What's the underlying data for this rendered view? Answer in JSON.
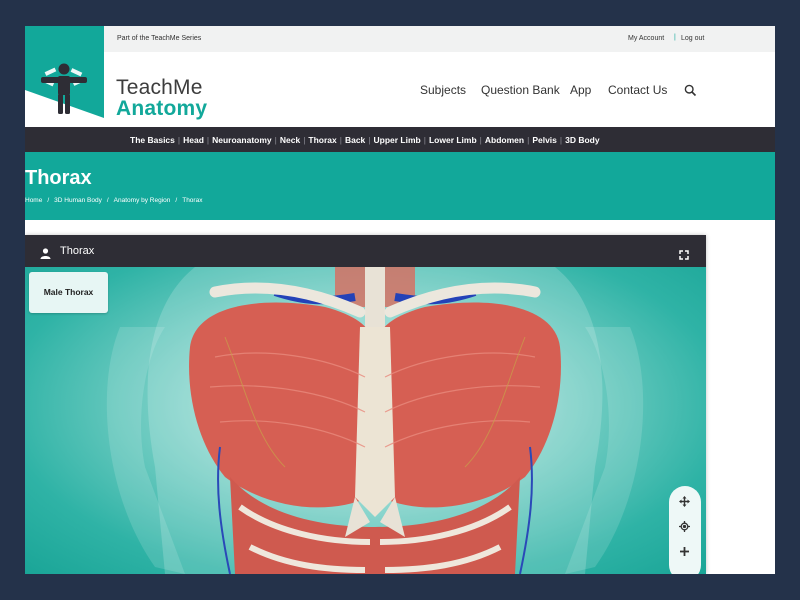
{
  "topbar": {
    "series_text": "Part of the TeachMe Series",
    "my_account": "My Account",
    "separator": "|",
    "log_out": "Log out"
  },
  "brand": {
    "line1": "TeachMe",
    "line2": "Anatomy"
  },
  "main_nav": [
    {
      "label": "Subjects"
    },
    {
      "label": "Question Bank"
    },
    {
      "label": "App"
    },
    {
      "label": "Contact Us"
    }
  ],
  "region_nav": [
    {
      "label": "The Basics"
    },
    {
      "label": "Head"
    },
    {
      "label": "Neuroanatomy"
    },
    {
      "label": "Neck"
    },
    {
      "label": "Thorax"
    },
    {
      "label": "Back"
    },
    {
      "label": "Upper Limb"
    },
    {
      "label": "Lower Limb"
    },
    {
      "label": "Abdomen"
    },
    {
      "label": "Pelvis"
    },
    {
      "label": "3D Body"
    }
  ],
  "banner": {
    "title": "Thorax",
    "breadcrumbs": [
      "Home",
      "3D Human Body",
      "Anatomy by Region",
      "Thorax"
    ],
    "breadcrumb_sep": "/"
  },
  "viewer": {
    "title": "Thorax",
    "model_button": "Male Thorax",
    "icons": [
      "person-icon",
      "fullscreen-icon",
      "move-icon",
      "rotate-icon",
      "zoom-in-icon"
    ]
  },
  "colors": {
    "teal": "#12a89a",
    "dark_nav": "#2e2d35",
    "frame": "#24324a"
  }
}
